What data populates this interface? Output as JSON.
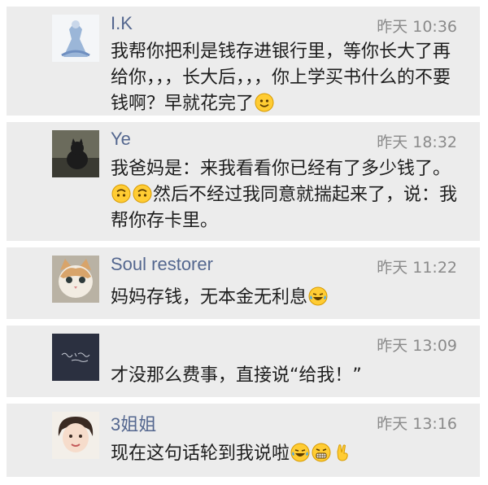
{
  "comments": [
    {
      "user": "I.K",
      "time": "昨天 10:36",
      "text": "我帮你把利是钱存进银行里，等你长大了再给你，，，长大后，，，你上学买书什么的不要钱啊？早就花完了",
      "emojis": [
        "smiling-face"
      ]
    },
    {
      "user": "Ye",
      "time": "昨天 18:32",
      "text_a": "我爸妈是：来我看看你已经有了多少钱了。",
      "text_b": "然后不经过我同意就揣起来了，说：我帮你存卡里。",
      "emojis": [
        "upside-down-face",
        "upside-down-face"
      ]
    },
    {
      "user": "Soul restorer",
      "time": "昨天 11:22",
      "text": "妈妈存钱，无本金无利息",
      "emojis": [
        "crying-laughing-face"
      ]
    },
    {
      "user": "",
      "time": "昨天 13:09",
      "text": "才没那么费事，直接说“给我！”",
      "emojis": []
    },
    {
      "user": "3姐姐",
      "time": "昨天 13:16",
      "text": "现在这句话轮到我说啦",
      "emojis": [
        "crying-laughing-face",
        "grinning-face",
        "victory-hand"
      ]
    }
  ],
  "colors": {
    "card_bg": "#ececec",
    "username": "#54678f",
    "timestamp": "#8a8a8a",
    "body_text": "#1d1d1d"
  }
}
